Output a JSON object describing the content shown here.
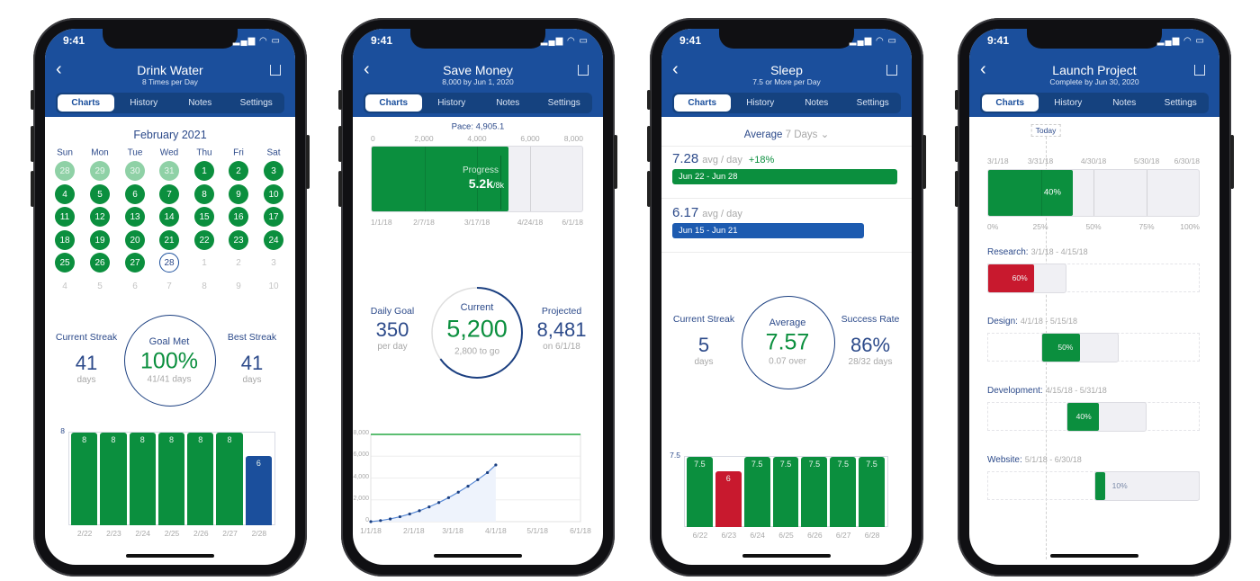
{
  "status_time": "9:41",
  "colors": {
    "header": "#1b4f9c",
    "green": "#0b8f3e",
    "light_green": "#8fd1a6",
    "red": "#c8192e",
    "blue": "#1d5bb0",
    "track": "#f0f0f4"
  },
  "tabs": [
    "Charts",
    "History",
    "Notes",
    "Settings"
  ],
  "phones": [
    {
      "title": "Drink Water",
      "subtitle": "8 Times per Day",
      "month_title": "February 2021",
      "weekdays": [
        "Sun",
        "Mon",
        "Tue",
        "Wed",
        "Thu",
        "Fri",
        "Sat"
      ],
      "calendar": [
        [
          [
            "28",
            "prev"
          ],
          [
            "29",
            "prev"
          ],
          [
            "30",
            "prev"
          ],
          [
            "31",
            "prev"
          ],
          [
            "1",
            "done"
          ],
          [
            "2",
            "done"
          ],
          [
            "3",
            "done"
          ]
        ],
        [
          [
            "4",
            "done"
          ],
          [
            "5",
            "done"
          ],
          [
            "6",
            "done"
          ],
          [
            "7",
            "done"
          ],
          [
            "8",
            "done"
          ],
          [
            "9",
            "done"
          ],
          [
            "10",
            "done"
          ]
        ],
        [
          [
            "11",
            "done"
          ],
          [
            "12",
            "done"
          ],
          [
            "13",
            "done"
          ],
          [
            "14",
            "done"
          ],
          [
            "15",
            "done"
          ],
          [
            "16",
            "done"
          ],
          [
            "17",
            "done"
          ]
        ],
        [
          [
            "18",
            "done"
          ],
          [
            "19",
            "done"
          ],
          [
            "20",
            "done"
          ],
          [
            "21",
            "done"
          ],
          [
            "22",
            "done"
          ],
          [
            "23",
            "done"
          ],
          [
            "24",
            "done"
          ]
        ],
        [
          [
            "25",
            "done"
          ],
          [
            "26",
            "done"
          ],
          [
            "27",
            "done"
          ],
          [
            "28",
            "today"
          ],
          [
            "1",
            "future"
          ],
          [
            "2",
            "future"
          ],
          [
            "3",
            "future"
          ]
        ],
        [
          [
            "4",
            "future"
          ],
          [
            "5",
            "future"
          ],
          [
            "6",
            "future"
          ],
          [
            "7",
            "future"
          ],
          [
            "8",
            "future"
          ],
          [
            "9",
            "future"
          ],
          [
            "10",
            "future"
          ]
        ]
      ],
      "stats": {
        "left": {
          "label": "Current Streak",
          "value": "41",
          "unit": "days"
        },
        "center": {
          "label": "Goal Met",
          "value": "100%",
          "note": "41/41 days"
        },
        "right": {
          "label": "Best Streak",
          "value": "41",
          "unit": "days"
        }
      }
    },
    {
      "title": "Save Money",
      "subtitle": "8,000 by Jun 1, 2020",
      "pace_label": "Pace: 4,905.1",
      "progress_ticks": [
        "0",
        "2,000",
        "4,000",
        "6,000",
        "8,000"
      ],
      "progress_dates": [
        "1/1/18",
        "2/7/18",
        "3/17/18",
        "4/24/18",
        "6/1/18"
      ],
      "progress": {
        "label": "Progress",
        "value_text": "5.2k",
        "goal_text": "/8k",
        "value": 5200,
        "goal": 8000,
        "pace": 4905.1
      },
      "stats": {
        "left": {
          "label": "Daily Goal",
          "value": "350",
          "unit": "per day"
        },
        "center": {
          "label": "Current",
          "value": "5,200",
          "note": "2,800 to go",
          "fraction": 0.65
        },
        "right": {
          "label": "Projected",
          "value": "8,481",
          "unit": "on 6/1/18"
        }
      }
    },
    {
      "title": "Sleep",
      "subtitle": "7.5 or More per Day",
      "average_label": "Average",
      "average_range": "7 Days",
      "periods": [
        {
          "value": "7.28",
          "unit": "avg / day",
          "change": "+18%",
          "range": "Jun 22 - Jun 28",
          "color": "#0b8f3e",
          "avg": 7.28
        },
        {
          "value": "6.17",
          "unit": "avg / day",
          "change": "",
          "range": "Jun 15 - Jun 21",
          "color": "#1d5bb0",
          "avg": 6.17
        }
      ],
      "stats": {
        "left": {
          "label": "Current Streak",
          "value": "5",
          "unit": "days"
        },
        "center": {
          "label": "Average",
          "value": "7.57",
          "note": "0.07 over"
        },
        "right": {
          "label": "Success Rate",
          "value": "86%",
          "unit": "28/32 days"
        }
      }
    },
    {
      "title": "Launch Project",
      "subtitle": "Complete by Jun 30, 2020",
      "today_label": "Today",
      "timeline_dates": [
        "3/1/18",
        "3/31/18",
        "4/30/18",
        "5/30/18",
        "6/30/18"
      ],
      "percent_ticks": [
        "0%",
        "25%",
        "50%",
        "75%",
        "100%"
      ],
      "overall": {
        "value": 40,
        "label": "40%"
      },
      "tasks": [
        {
          "name": "Research:",
          "range": "3/1/18 - 4/15/18",
          "start": "2018-03-01",
          "end": "2018-04-15",
          "progress": 60,
          "label": "60%",
          "color": "#c8192e"
        },
        {
          "name": "Design:",
          "range": "4/1/18 - 5/15/18",
          "start": "2018-04-01",
          "end": "2018-05-15",
          "progress": 50,
          "label": "50%",
          "color": "#0b8f3e"
        },
        {
          "name": "Development:",
          "range": "4/15/18 - 5/31/18",
          "start": "2018-04-15",
          "end": "2018-05-31",
          "progress": 40,
          "label": "40%",
          "color": "#0b8f3e"
        },
        {
          "name": "Website:",
          "range": "5/1/18 - 6/30/18",
          "start": "2018-05-01",
          "end": "2018-06-30",
          "progress": 10,
          "label": "10%",
          "color": "#0b8f3e"
        }
      ]
    }
  ],
  "chart_data": [
    {
      "type": "bar",
      "categories": [
        "2/22",
        "2/23",
        "2/24",
        "2/25",
        "2/26",
        "2/27",
        "2/28"
      ],
      "values": [
        8,
        8,
        8,
        8,
        8,
        8,
        6
      ],
      "ylim": [
        0,
        8
      ],
      "y_tick_labels": [
        "8"
      ],
      "colors": [
        "#0b8f3e",
        "#0b8f3e",
        "#0b8f3e",
        "#0b8f3e",
        "#0b8f3e",
        "#0b8f3e",
        "#1b4f9c"
      ],
      "data_labels": true
    },
    {
      "type": "area",
      "x": [
        "1/1/18",
        "1/8/18",
        "1/15/18",
        "1/22/18",
        "1/29/18",
        "2/5/18",
        "2/12/18",
        "2/19/18",
        "2/26/18",
        "3/5/18",
        "3/12/18",
        "3/19/18",
        "3/26/18",
        "4/1/18"
      ],
      "values": [
        0,
        100,
        250,
        450,
        700,
        1000,
        1350,
        1750,
        2200,
        2700,
        3250,
        3850,
        4500,
        5200
      ],
      "goal": 8000,
      "ylim": [
        0,
        8000
      ],
      "y_tick_labels": [
        "0",
        "2,000",
        "4,000",
        "6,000",
        "8,000"
      ],
      "x_tick_labels": [
        "1/1/18",
        "2/1/18",
        "3/1/18",
        "4/1/18",
        "5/1/18",
        "6/1/18"
      ],
      "grid": true
    },
    {
      "type": "bar",
      "categories": [
        "6/22",
        "6/23",
        "6/24",
        "6/25",
        "6/26",
        "6/27",
        "6/28"
      ],
      "values": [
        7.5,
        6,
        7.5,
        7.5,
        7.5,
        7.5,
        7.5
      ],
      "ylim": [
        0,
        7.5
      ],
      "y_tick_labels": [
        "7.5"
      ],
      "colors": [
        "#0b8f3e",
        "#c8192e",
        "#0b8f3e",
        "#0b8f3e",
        "#0b8f3e",
        "#0b8f3e",
        "#0b8f3e"
      ],
      "data_labels": true
    }
  ]
}
